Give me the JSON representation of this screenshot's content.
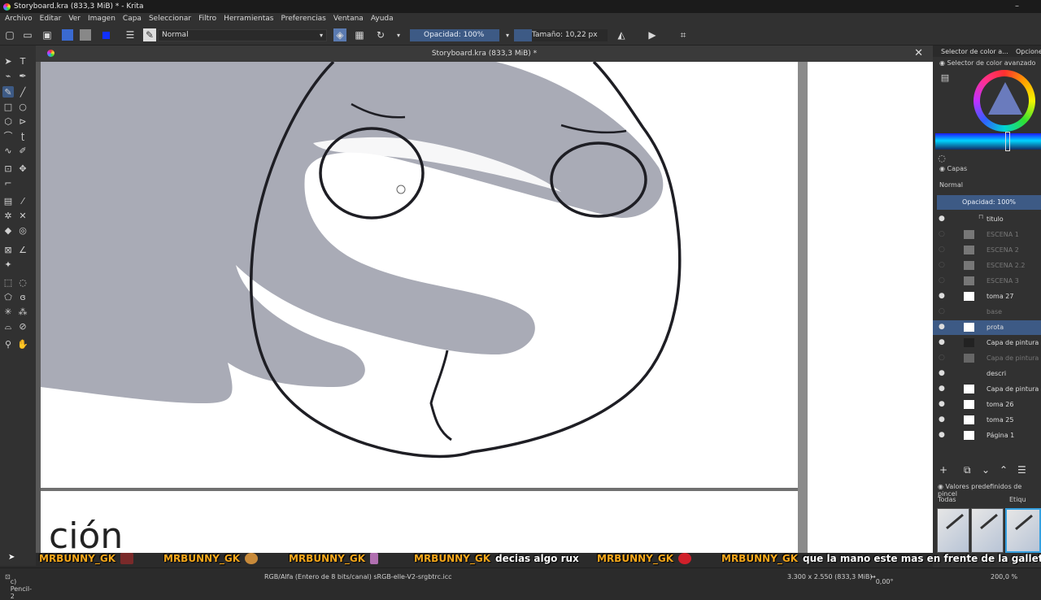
{
  "window": {
    "title": "Storyboard.kra (833,3 MiB) * - Krita",
    "controls": [
      "–"
    ]
  },
  "menu": [
    "Archivo",
    "Editar",
    "Ver",
    "Imagen",
    "Capa",
    "Seleccionar",
    "Filtro",
    "Herramientas",
    "Preferencias",
    "Ventana",
    "Ayuda"
  ],
  "toolbar": {
    "blend_mode": "Normal",
    "opacity_label": "Opacidad: 100%",
    "size_label": "Tamaño: 10,22 px"
  },
  "document": {
    "tab_title": "Storyboard.kra (833,3 MiB) *",
    "visible_text": "ción"
  },
  "dockers": {
    "tab1": "Selector de color a...",
    "tab2": "Opcione",
    "color_panel_title": "Selector de color avanzado",
    "layers_title": "Capas",
    "layers_blend": "Normal",
    "layers_opacity": "Opacidad:  100%",
    "layers": [
      {
        "name": "titulo",
        "visible": true,
        "dim": false,
        "selected": false
      },
      {
        "name": "ESCENA 1",
        "visible": false,
        "dim": true,
        "selected": false
      },
      {
        "name": "ESCENA 2",
        "visible": false,
        "dim": true,
        "selected": false
      },
      {
        "name": "ESCENA 2.2",
        "visible": false,
        "dim": true,
        "selected": false
      },
      {
        "name": "ESCENA 3",
        "visible": false,
        "dim": true,
        "selected": false
      },
      {
        "name": "toma 27",
        "visible": true,
        "dim": false,
        "selected": false
      },
      {
        "name": "base",
        "visible": false,
        "dim": true,
        "selected": false
      },
      {
        "name": "prota",
        "visible": true,
        "dim": false,
        "selected": true
      },
      {
        "name": "Capa de pintura",
        "visible": true,
        "dim": false,
        "selected": false
      },
      {
        "name": "Capa de pintura",
        "visible": false,
        "dim": true,
        "selected": false
      },
      {
        "name": "descri",
        "visible": true,
        "dim": false,
        "selected": false
      },
      {
        "name": "Capa de pintura",
        "visible": true,
        "dim": false,
        "selected": false
      },
      {
        "name": "toma 26",
        "visible": true,
        "dim": false,
        "selected": false
      },
      {
        "name": "toma 25",
        "visible": true,
        "dim": false,
        "selected": false
      },
      {
        "name": "Página 1",
        "visible": true,
        "dim": false,
        "selected": false
      }
    ],
    "presets_title": "Valores predefinidos de pincel",
    "presets_filter": "Todas",
    "presets_tag": "Etiqu"
  },
  "chat": [
    {
      "user": "MRBUNNY_GK",
      "msg": ""
    },
    {
      "user": "MRBUNNY_GK",
      "msg": ""
    },
    {
      "user": "MRBUNNY_GK",
      "msg": ""
    },
    {
      "user": "MRBUNNY_GK",
      "msg": "decias algo rux"
    },
    {
      "user": "MRBUNNY_GK",
      "msg": ""
    },
    {
      "user": "MRBUNNY_GK",
      "msg": "que la mano este mas en frente de la galleta"
    }
  ],
  "status": {
    "brush": "c) Pencil-2",
    "colorspace": "RGB/Alfa (Entero de 8 bits/canal)  sRGB-elle-V2-srgbtrc.icc",
    "dimensions": "3.300 x 2.550 (833,3 MiB)",
    "rotation": "0,00°",
    "zoom": "200,0 %"
  },
  "colors": {
    "accent": "#3d5a85",
    "chat_user": "#f7a81b"
  }
}
